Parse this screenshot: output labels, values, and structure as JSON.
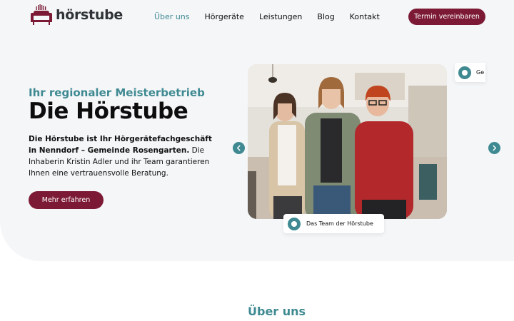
{
  "brand": {
    "name": "hörstube",
    "accent": "#7c1a36",
    "teal": "#3f8a92"
  },
  "nav": {
    "items": [
      {
        "label": "Über uns",
        "active": true
      },
      {
        "label": "Hörgeräte"
      },
      {
        "label": "Leistungen"
      },
      {
        "label": "Blog"
      },
      {
        "label": "Kontakt"
      }
    ]
  },
  "header": {
    "cta_label": "Termin vereinbaren"
  },
  "hero": {
    "subtitle": "Ihr regionaler Meisterbetrieb",
    "title": "Die Hörstube",
    "intro_bold": "Die Hörstube ist Ihr Hörgerätefachgeschäft in Nenndorf – Gemeinde Rosengarten.",
    "intro_rest": " Die Inhaberin Kristin Adler und ihr Team garantieren Ihnen eine vertrauensvolle Beratung.",
    "button_label": "Mehr erfahren"
  },
  "carousel": {
    "current_caption": "Das Team der Hörstube",
    "next_caption_partial": "Ge",
    "prev_icon": "chevron-left-icon",
    "next_icon": "chevron-right-icon"
  },
  "section": {
    "heading": "Über uns"
  }
}
